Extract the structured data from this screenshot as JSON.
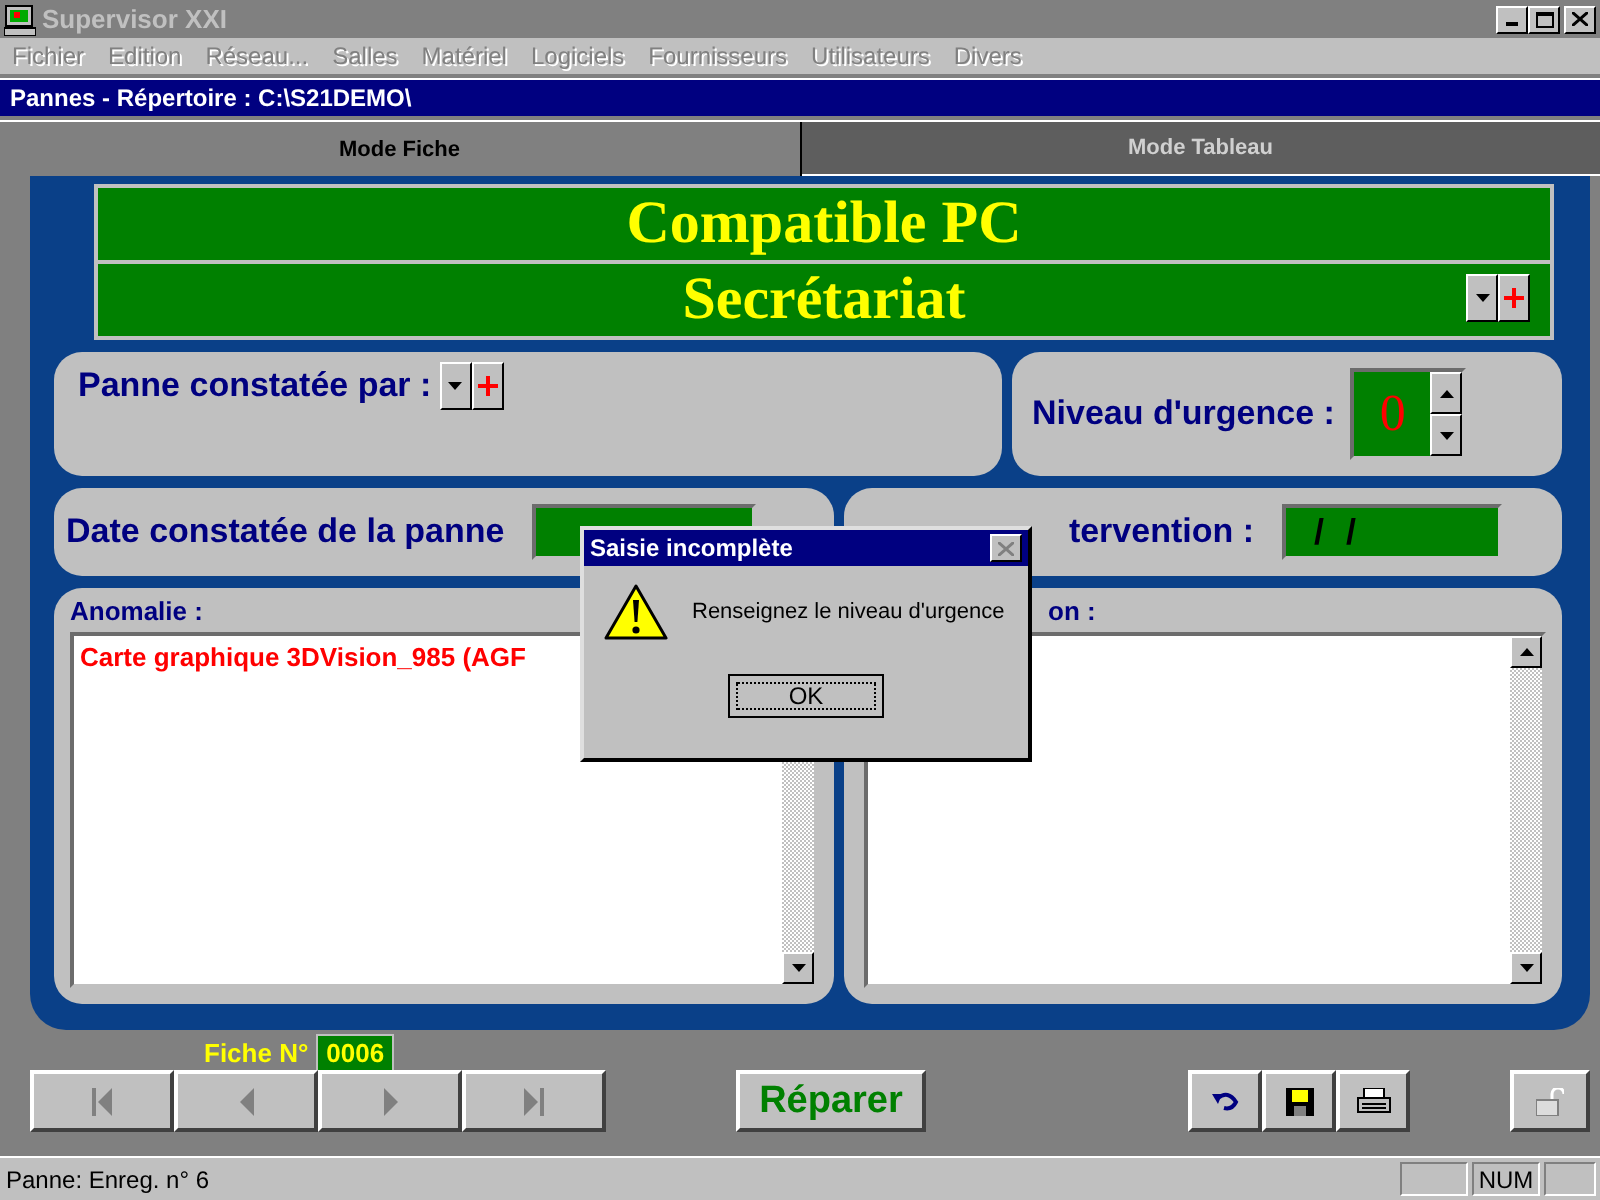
{
  "window": {
    "title": "Supervisor XXI",
    "active": false
  },
  "menu": [
    {
      "label": "Fichier",
      "disabled": true
    },
    {
      "label": "Edition",
      "disabled": true
    },
    {
      "label": "Réseau...",
      "disabled": true
    },
    {
      "label": "Salles",
      "disabled": true
    },
    {
      "label": "Matériel",
      "disabled": true
    },
    {
      "label": "Logiciels",
      "disabled": true
    },
    {
      "label": "Fournisseurs",
      "disabled": true
    },
    {
      "label": "Utilisateurs",
      "disabled": true
    },
    {
      "label": "Divers",
      "disabled": true
    }
  ],
  "child_title": "Pannes - Répertoire : C:\\S21DEMO\\",
  "tabs": [
    {
      "label": "Mode Fiche",
      "selected": true
    },
    {
      "label": "Mode Tableau",
      "selected": false
    }
  ],
  "header": {
    "line_1": "Compatible PC",
    "line_2": "Secrétariat"
  },
  "reported_by": {
    "label": "Panne constatée par :"
  },
  "urgency": {
    "label": "Niveau d'urgence :",
    "value": "0"
  },
  "date_reported": {
    "label": "Date constatée de la panne"
  },
  "intervention": {
    "label": "tervention :",
    "value": "/ /"
  },
  "anomaly": {
    "label": "Anomalie :",
    "text": "Carte graphique 3DVision_985 (AGF"
  },
  "solution": {
    "label": "on :"
  },
  "record": {
    "label": "Fiche N°",
    "number": "0006"
  },
  "repair_button": "Réparer",
  "dialog": {
    "title": "Saisie incomplète",
    "message": "Renseignez le niveau d'urgence",
    "button": "OK"
  },
  "status_bar": {
    "text": "Panne: Enreg. n° 6",
    "panel_2": "NUM"
  }
}
